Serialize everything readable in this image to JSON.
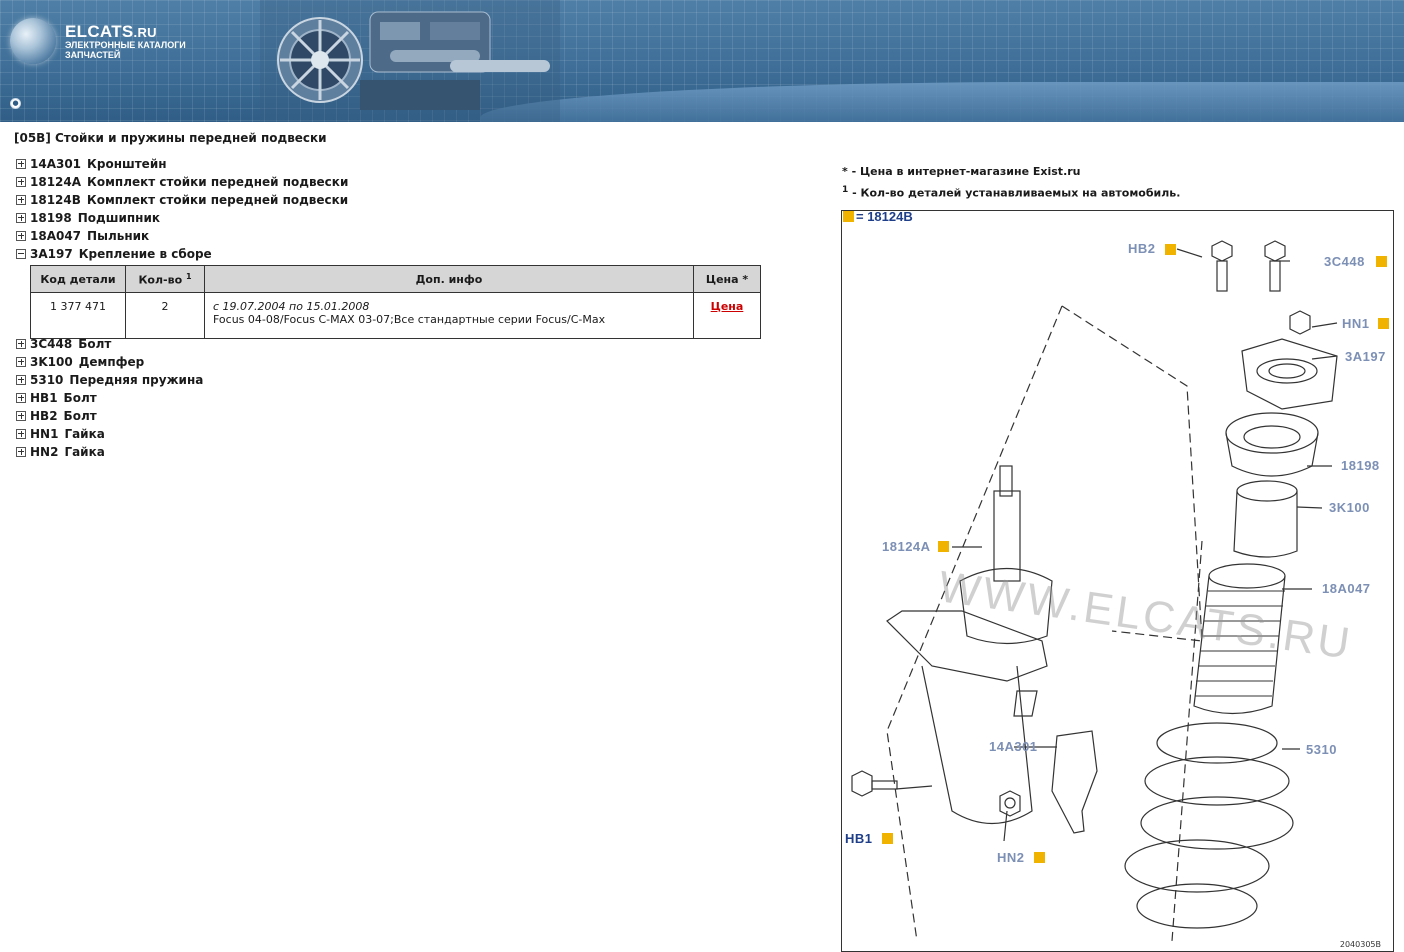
{
  "header": {
    "logo_title": "ELCATS",
    "logo_domain": ".RU",
    "logo_subtitle": "ЭЛЕКТРОННЫЕ КАТАЛОГИ ЗАПЧАСТЕЙ"
  },
  "page_title": "[05B] Стойки и пружины передней подвески",
  "tree": [
    {
      "code": "14A301",
      "name": "Кронштейн",
      "expanded": false
    },
    {
      "code": "18124A",
      "name": "Комплект стойки передней подвески",
      "expanded": false
    },
    {
      "code": "18124B",
      "name": "Комплект стойки передней подвески",
      "expanded": false
    },
    {
      "code": "18198",
      "name": "Подшипник",
      "expanded": false
    },
    {
      "code": "18A047",
      "name": "Пыльник",
      "expanded": false
    },
    {
      "code": "3A197",
      "name": "Крепление в сборе",
      "expanded": true
    },
    {
      "code": "3C448",
      "name": "Болт",
      "expanded": false
    },
    {
      "code": "3K100",
      "name": "Демпфер",
      "expanded": false
    },
    {
      "code": "5310",
      "name": "Передняя пружина",
      "expanded": false
    },
    {
      "code": "HB1",
      "name": "Болт",
      "expanded": false
    },
    {
      "code": "HB2",
      "name": "Болт",
      "expanded": false
    },
    {
      "code": "HN1",
      "name": "Гайка",
      "expanded": false
    },
    {
      "code": "HN2",
      "name": "Гайка",
      "expanded": false
    }
  ],
  "table": {
    "headers": {
      "code": "Код детали",
      "qty": "Кол-во",
      "qty_sup": "1",
      "info": "Доп. инфо",
      "price": "Цена *"
    },
    "rows": [
      {
        "code": "1 377 471",
        "qty": "2",
        "info_date": "с 19.07.2004 по 15.01.2008",
        "info_text": "Focus 04-08/Focus C-MAX 03-07;Все стандартные серии Focus/C-Max",
        "price_link": "Цена"
      }
    ]
  },
  "notes": {
    "price_note": "* - Цена в интернет-магазине Exist.ru",
    "qty_note_sup": "1",
    "qty_note": " - Кол-во деталей устанавливаемых на автомобиль."
  },
  "diagram": {
    "legend": "= 18124B",
    "watermark": "WWW.ELCATS.RU",
    "figure_number": "2040305B",
    "callouts": {
      "hb2": "HB2",
      "c3448": "3C448",
      "hn1": "HN1",
      "a3197": "3A197",
      "p18198": "18198",
      "k3100": "3K100",
      "a18047": "18A047",
      "p18124a": "18124A",
      "a14301": "14A301",
      "p5310": "5310",
      "hb1": "HB1",
      "hn2": "HN2"
    },
    "marker_color": "#f0b400"
  }
}
